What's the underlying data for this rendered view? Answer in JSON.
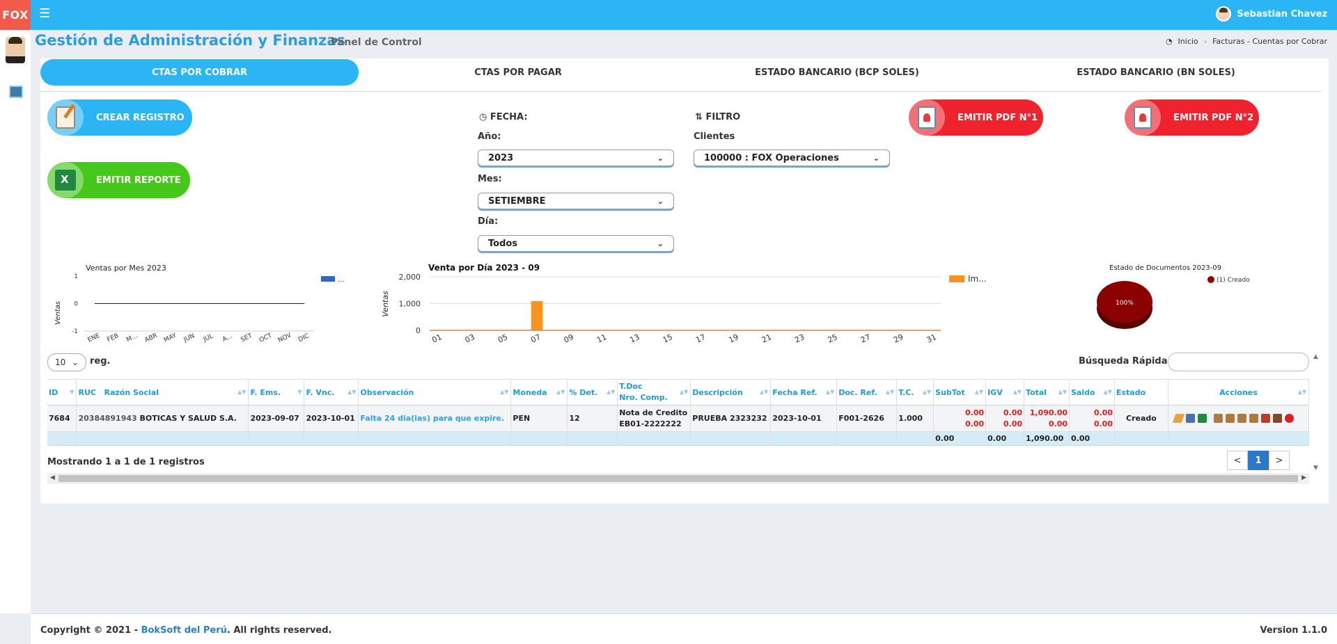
{
  "header": {
    "brand": "FOX",
    "menu_icon": "☰",
    "user_name": "Sebastian Chavez"
  },
  "page": {
    "title": "Gestión de Administración y Finanzas",
    "subtitle": "Panel de Control",
    "breadcrumb": [
      "Inicio",
      "Facturas - Cuentas por Cobrar"
    ]
  },
  "tabs": [
    {
      "label": "CTAS POR COBRAR",
      "active": true
    },
    {
      "label": "CTAS POR PAGAR",
      "active": false
    },
    {
      "label": "ESTADO BANCARIO (BCP SOLES)",
      "active": false
    },
    {
      "label": "ESTADO BANCARIO (BN SOLES)",
      "active": false
    }
  ],
  "actions": {
    "create": "CREAR REGISTRO",
    "report": "EMITIR REPORTE",
    "pdf1": "EMITIR PDF N°1",
    "pdf2": "EMITIR PDF N°2"
  },
  "filters": {
    "fecha_head": "FECHA:",
    "filtro_head": "FILTRO",
    "year_label": "Año:",
    "year_value": "2023",
    "month_label": "Mes:",
    "month_value": "SETIEMBRE",
    "day_label": "Día:",
    "day_value": "Todos",
    "client_label": "Clientes",
    "client_value": "100000 : FOX Operaciones"
  },
  "colors": {
    "accent": "#2cb5f5",
    "brand": "#f25a4b",
    "green": "#45c71b",
    "red": "#f0222e",
    "bar_orange": "#f7931e",
    "line_blue": "#3366cc",
    "pie_dark": "#8b0000"
  },
  "chart_data": [
    {
      "type": "line",
      "title": "Ventas por Mes 2023",
      "ylabel": "Ventas",
      "xlabel": "",
      "categories": [
        "ENE",
        "FEB",
        "M...",
        "ABR",
        "MAY",
        "JUN",
        "JUL",
        "A...",
        "SET",
        "OCT",
        "NOV",
        "DIC"
      ],
      "y_ticks": [
        "1",
        "0",
        "-1"
      ],
      "ylim": [
        -1,
        1
      ],
      "legend": "...",
      "series": [
        {
          "values": [
            0,
            0,
            0,
            0,
            0,
            0,
            0,
            0,
            0,
            0,
            0,
            0
          ]
        }
      ]
    },
    {
      "type": "bar",
      "title": "Venta por Día 2023 - 09",
      "ylabel": "Ventas",
      "xlabel": "",
      "x_ticks": [
        "01",
        "03",
        "05",
        "07",
        "09",
        "11",
        "13",
        "15",
        "17",
        "19",
        "21",
        "23",
        "25",
        "27",
        "29",
        "31"
      ],
      "y_ticks": [
        "2,000",
        "1,000",
        "0"
      ],
      "ylim": [
        0,
        2000
      ],
      "legend": "Im...",
      "series": [
        {
          "x": [
            1,
            2,
            3,
            4,
            5,
            6,
            7,
            8,
            9,
            10,
            11,
            12,
            13,
            14,
            15,
            16,
            17,
            18,
            19,
            20,
            21,
            22,
            23,
            24,
            25,
            26,
            27,
            28,
            29,
            30,
            31
          ],
          "values": [
            0,
            0,
            0,
            0,
            0,
            0,
            1090,
            0,
            0,
            0,
            0,
            0,
            0,
            0,
            0,
            0,
            0,
            0,
            0,
            0,
            0,
            0,
            0,
            0,
            0,
            0,
            0,
            0,
            0,
            0,
            0
          ]
        }
      ]
    },
    {
      "type": "pie",
      "title": "Estado de Documentos 2023-09",
      "legend_entries": [
        "(1) Creado"
      ],
      "slice_label": "100%",
      "values": [
        100
      ]
    }
  ],
  "table_controls": {
    "length_value": "10",
    "length_label": "reg.",
    "search_label": "Búsqueda Rápida:"
  },
  "table": {
    "headers": {
      "id": "ID",
      "ruc": "RUC",
      "razon": "Razón Social",
      "fems": "F. Ems.",
      "fvnc": "F. Vnc.",
      "obs": "Observación",
      "moneda": "Moneda",
      "det": "% Det.",
      "tdoc": "T.Doc",
      "ncomp": "Nro. Comp.",
      "desc": "Descripción",
      "fref": "Fecha Ref.",
      "dref": "Doc. Ref.",
      "tc": "T.C.",
      "subtot": "SubTot",
      "igv": "IGV",
      "total": "Total",
      "saldo": "Saldo",
      "estado": "Estado",
      "acciones": "Acciones"
    },
    "row": {
      "id": "7684",
      "ruc": "20384891943",
      "razon": "BOTICAS Y SALUD S.A.",
      "fems": "2023-09-07",
      "fvnc": "2023-10-01",
      "obs": "Falta 24 dia(ias) para que expire.",
      "moneda": "PEN",
      "det": "12",
      "tdoc": "Nota de Credito",
      "ncomp": "EB01-2222222",
      "desc": "PRUEBA 2323232",
      "fref": "2023-10-01",
      "dref": "F001-2626",
      "tc": "1.000",
      "subtot_1": "0.00",
      "subtot_2": "0.00",
      "igv_1": "0.00",
      "igv_2": "0.00",
      "total_1": "1,090.00",
      "total_2": "0.00",
      "saldo_1": "0.00",
      "saldo_2": "0.00",
      "estado": "Creado"
    },
    "footer": {
      "subtot": "0.00",
      "igv": "0.00",
      "total": "1,090.00",
      "saldo": "0.00"
    }
  },
  "pagination": {
    "info": "Mostrando 1 a 1 de 1 registros",
    "prev": "<",
    "current": "1",
    "next": ">"
  },
  "footer": {
    "copyright_prefix": "Copyright © 2021 - ",
    "company": "BokSoft del Perú",
    "copyright_suffix": ". All rights reserved.",
    "version": "Version 1.1.0"
  }
}
